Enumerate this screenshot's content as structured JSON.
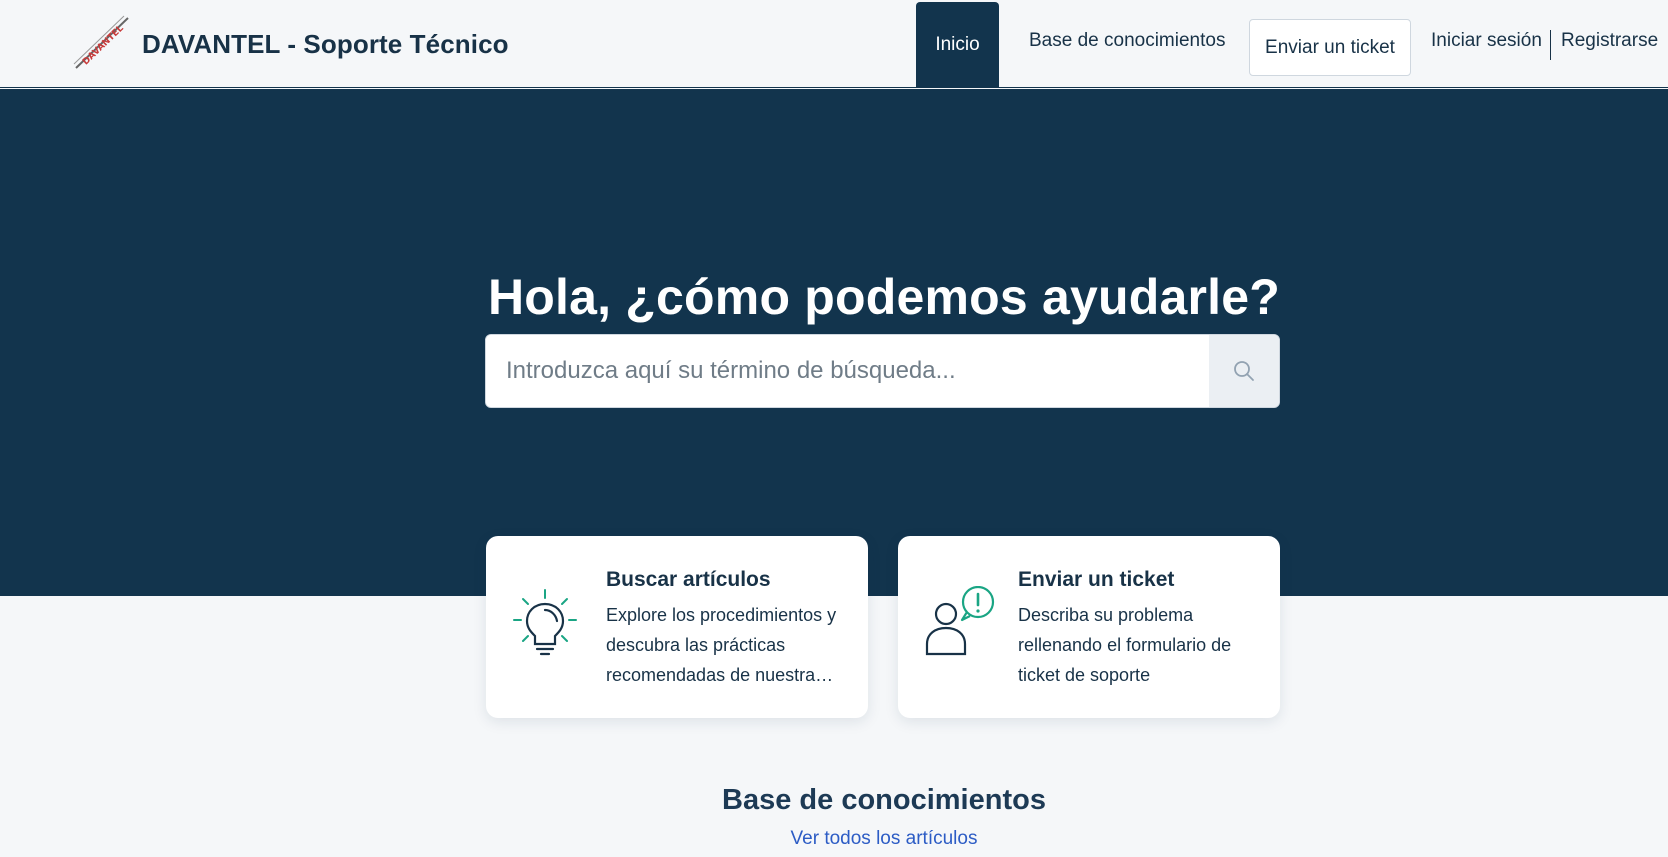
{
  "header": {
    "brand_title": "DAVANTEL - Soporte Técnico",
    "logo_text": "DAVANTEL",
    "nav": {
      "home": "Inicio",
      "knowledge_base": "Base de conocimientos",
      "submit_ticket": "Enviar un ticket",
      "login": "Iniciar sesión",
      "register": "Registrarse"
    }
  },
  "hero": {
    "title": "Hola, ¿cómo podemos ayudarle?",
    "search_placeholder": "Introduzca aquí su término de búsqueda..."
  },
  "cards": [
    {
      "title": "Buscar artículos",
      "description": "Explore los procedimientos y descubra las prácticas recomendadas de nuestra base de conocimientos",
      "icon": "lightbulb-icon"
    },
    {
      "title": "Enviar un ticket",
      "description": "Describa su problema rellenando el formulario de ticket de soporte",
      "icon": "user-alert-icon"
    }
  ],
  "knowledge_base": {
    "title": "Base de conocimientos",
    "view_all": "Ver todos los artículos"
  },
  "colors": {
    "primary": "#12344d",
    "accent": "#1aa584",
    "link": "#2c5cc5",
    "background": "#f5f7f9"
  }
}
